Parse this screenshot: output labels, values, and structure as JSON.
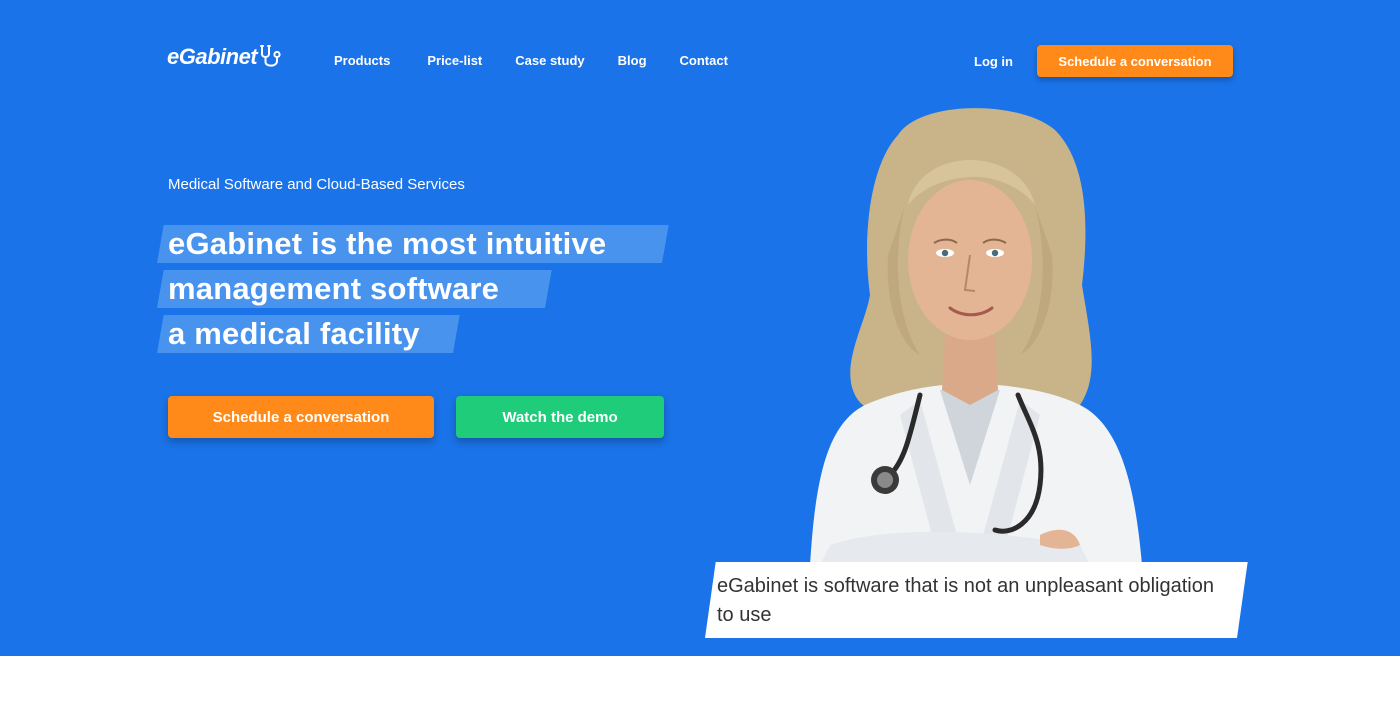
{
  "brand": {
    "name": "eGabinet",
    "logo_icon": "stethoscope-icon"
  },
  "nav": {
    "items": [
      {
        "label": "Products"
      },
      {
        "label": "Price-list"
      },
      {
        "label": "Case study"
      },
      {
        "label": "Blog"
      },
      {
        "label": "Contact"
      }
    ],
    "login_label": "Log in",
    "cta_label": "Schedule a conversation"
  },
  "hero": {
    "subtitle": "Medical Software and Cloud-Based Services",
    "headline_lines": [
      "eGabinet is the most intuitive",
      "management software",
      "a medical facility"
    ],
    "primary_button": "Schedule a conversation",
    "secondary_button": "Watch the demo",
    "quote": "eGabinet is software that is not an unpleasant obligation to use"
  },
  "colors": {
    "hero_background": "#1a73e8",
    "headline_highlight": "#4793ee",
    "accent_orange": "#ff8a1a",
    "accent_green": "#1fcc7a"
  }
}
